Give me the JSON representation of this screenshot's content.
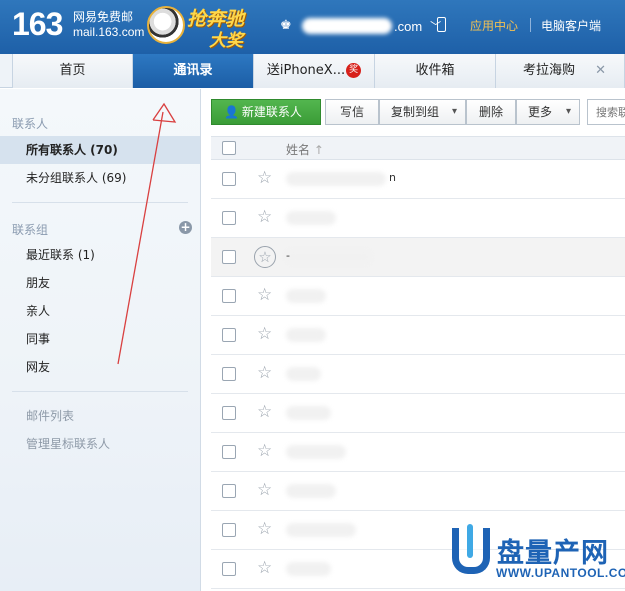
{
  "header": {
    "logo_number": "163",
    "logo_name": "网易免费邮",
    "logo_domain": "mail.163.com",
    "promo_line1": "抢奔驰",
    "promo_line2": "大奖",
    "user_domain": ".com",
    "app_center": "应用中心",
    "pc_client": "电脑客户端"
  },
  "tabs": [
    {
      "label": "首页"
    },
    {
      "label": "通讯录",
      "active": true
    },
    {
      "label": "送iPhoneX...",
      "badge": "奖"
    },
    {
      "label": "收件箱"
    },
    {
      "label": "考拉海购"
    }
  ],
  "sidebar": {
    "contacts_heading": "联系人",
    "items": [
      {
        "label": "所有联系人 (70)",
        "active": true
      },
      {
        "label": "未分组联系人 (69)"
      }
    ],
    "groups_heading": "联系组",
    "groups": [
      {
        "label": "最近联系 (1)"
      },
      {
        "label": "朋友"
      },
      {
        "label": "亲人"
      },
      {
        "label": "同事"
      },
      {
        "label": "网友"
      }
    ],
    "extra": [
      {
        "label": "邮件列表"
      },
      {
        "label": "管理星标联系人"
      }
    ]
  },
  "toolbar": {
    "new_contact": "新建联系人",
    "write": "写信",
    "copy_to_group": "复制到组",
    "delete": "删除",
    "more": "更多",
    "search_placeholder": "搜索联"
  },
  "table": {
    "name_header": "姓名",
    "sort_arrow": "↑",
    "rows": [
      {
        "tail": "n"
      },
      {
        "tail": ""
      },
      {
        "tail": "-"
      },
      {
        "tail": ""
      },
      {
        "tail": ""
      },
      {
        "tail": ""
      },
      {
        "tail": ""
      },
      {
        "tail": ""
      },
      {
        "tail": ""
      },
      {
        "tail": ""
      },
      {
        "tail": ""
      }
    ]
  },
  "watermark": {
    "title": "盘量产网",
    "url": "WWW.UPANTOOL.COM"
  },
  "colors": {
    "header_blue": "#1e60a8",
    "accent_green": "#3a9c37",
    "annotation_red": "#d94040"
  }
}
